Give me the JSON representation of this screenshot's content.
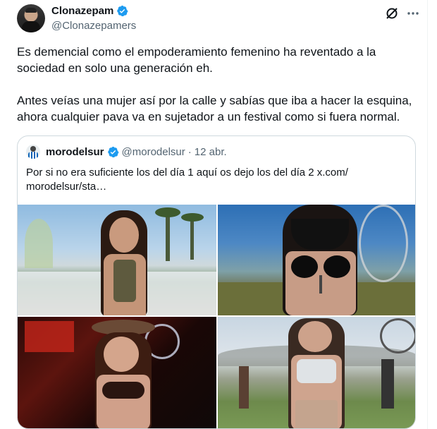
{
  "tweet": {
    "display_name": "Clonazepam",
    "handle": "@Clonazepamers",
    "verified": true,
    "text_lines": [
      "Es demencial como el empoderamiento femenino ha reventado a la",
      "sociedad en solo una generación eh.",
      "",
      "Antes veías una mujer así por la calle y sabías que iba a hacer la esquina,",
      "ahora cualquier pava va en sujetador a un festival como si fuera normal."
    ]
  },
  "top_actions": {
    "icons": [
      "grok-icon",
      "more-icon"
    ]
  },
  "quote": {
    "display_name": "morodelsur",
    "handle": "@morodelsur",
    "separator": "·",
    "date": "12 abr.",
    "verified": true,
    "text_line1": "Por si no era suficiente los del día 1 aquí os dejo los del día 2  x.com/",
    "text_line2": "morodelsur/sta…",
    "images": [
      "festival-photo-1",
      "festival-photo-2",
      "festival-photo-3",
      "festival-photo-4"
    ]
  },
  "colors": {
    "verified_blue": "#1d9bf0",
    "secondary_text": "#536471",
    "border": "#cfd9de"
  }
}
